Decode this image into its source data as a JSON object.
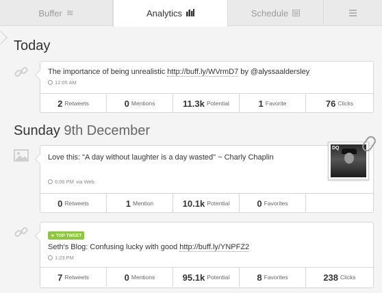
{
  "tabs": [
    {
      "label": "Buffer",
      "icon": "layers-icon"
    },
    {
      "label": "Analytics",
      "icon": "bar-chart-icon"
    },
    {
      "label": "Schedule",
      "icon": "calendar-icon"
    },
    {
      "label": "",
      "icon": "menu-icon"
    }
  ],
  "sections": [
    {
      "heading_bold": "Today",
      "heading_light": "",
      "tweets": [
        {
          "type_icon": "link-icon",
          "text_before": "The importance of being unrealistic ",
          "link": "http://buff.ly/WVrmD7",
          "text_after": " by @alyssaaldersley",
          "time": "12:05 AM",
          "via": "",
          "stats": [
            {
              "num": "2",
              "label": "Retweets"
            },
            {
              "num": "0",
              "label": "Mentions"
            },
            {
              "num": "11.3k",
              "label": "Potential"
            },
            {
              "num": "1",
              "label": "Favorite"
            },
            {
              "num": "76",
              "label": "Clicks"
            }
          ]
        }
      ]
    },
    {
      "heading_bold": "Sunday",
      "heading_light": "9th December",
      "tweets": [
        {
          "type_icon": "image-icon",
          "text": "Love this: \"A day without laughter is a day wasted\" ~ Charly Chaplin",
          "time": "6:06 PM",
          "via": "via Web",
          "thumb_label": "DQ",
          "stats": [
            {
              "num": "0",
              "label": "Retweets"
            },
            {
              "num": "1",
              "label": "Mention"
            },
            {
              "num": "10.1k",
              "label": "Potential"
            },
            {
              "num": "0",
              "label": "Favorites"
            },
            {
              "num": "",
              "label": ""
            }
          ]
        },
        {
          "type_icon": "link-icon",
          "badge": "★ TOP TWEET",
          "text_before": "Seth's Blog: Confusing lucky with good ",
          "link": "http://buff.ly/YNPFZ2",
          "text_after": "",
          "time": "1:23 PM",
          "via": "",
          "stats": [
            {
              "num": "7",
              "label": "Retweets"
            },
            {
              "num": "0",
              "label": "Mentions"
            },
            {
              "num": "95.1k",
              "label": "Potential"
            },
            {
              "num": "8",
              "label": "Favorites"
            },
            {
              "num": "238",
              "label": "Clicks"
            }
          ]
        }
      ]
    }
  ],
  "colors": {
    "badge": "#8dc63f",
    "active_tab": "#ffffff",
    "tab_bg": "#eaeaea"
  }
}
